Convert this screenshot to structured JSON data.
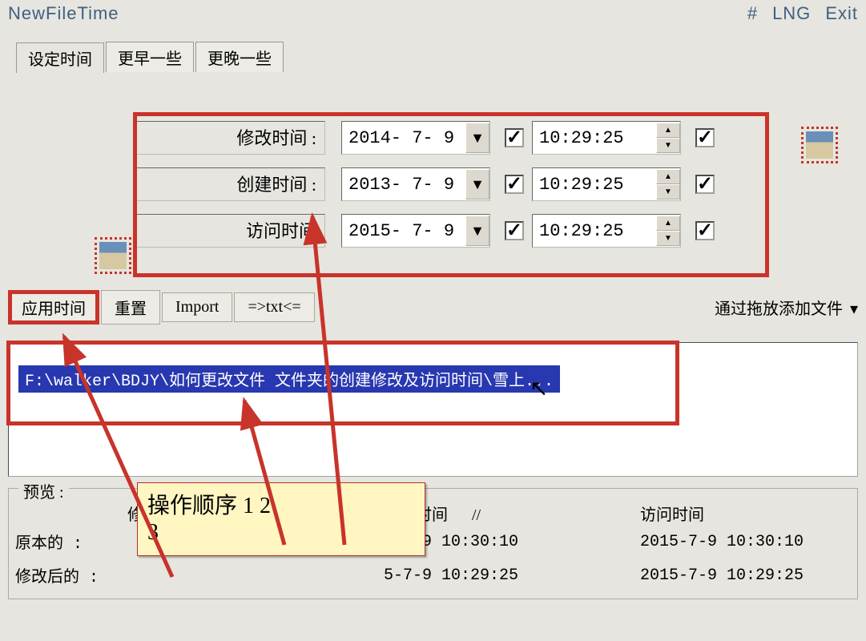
{
  "header": {
    "title": "NewFileTime",
    "hash": "#",
    "lng": "LNG",
    "exit": "Exit"
  },
  "tabs": {
    "set": "设定时间",
    "earlier": "更早一些",
    "later": "更晚一些"
  },
  "timeRows": {
    "modify": {
      "label": "修改时间 :",
      "date": "2014- 7- 9",
      "time": "10:29:25"
    },
    "create": {
      "label": "创建时间 :",
      "date": "2013- 7- 9",
      "time": "10:29:25"
    },
    "access": {
      "label": "访问时间",
      "date": "2015- 7- 9",
      "time": "10:29:25"
    }
  },
  "toolbar": {
    "apply": "应用时间",
    "reset": "重置",
    "import": "Import",
    "totxt": "=>txt<=",
    "dragHint": "通过拖放添加文件"
  },
  "file": {
    "selected": "F:\\walker\\BDJY\\如何更改文件 文件夹的创建修改及访问时间\\雪上..."
  },
  "preview": {
    "group": "预览 :",
    "hMod": "修改时间",
    "hCre": "创建时间",
    "sep": "//",
    "hAcc": "访问时间",
    "row1": {
      "label": "原本的 :",
      "mod": "",
      "cre": "5-7-9 10:30:10",
      "acc": "2015-7-9 10:30:10"
    },
    "row2": {
      "label": "修改后的 :",
      "mod": "",
      "cre": "5-7-9 10:29:25",
      "acc": "2015-7-9 10:29:25"
    }
  },
  "note": {
    "line1": "操作顺序   1   2",
    "line2": "3"
  }
}
